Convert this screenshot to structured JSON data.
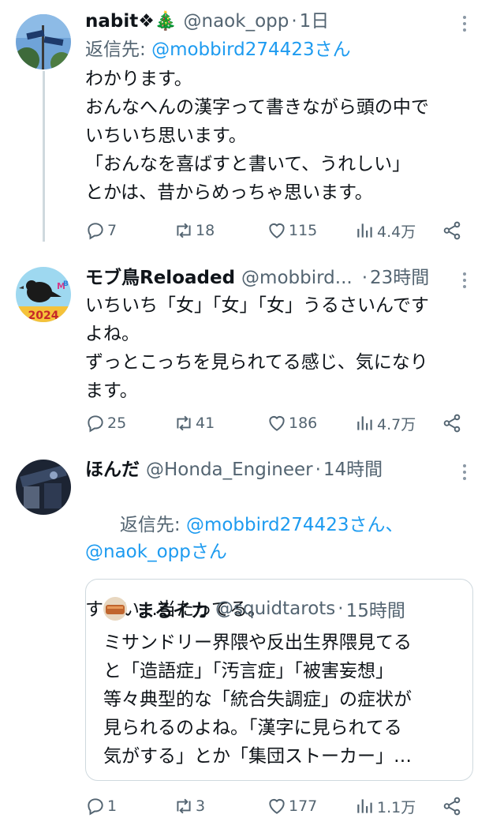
{
  "tweets": [
    {
      "name": "nabit❖🎄",
      "handle": "@naok_opp",
      "dot": "·",
      "time": "1日",
      "reply_prefix": "返信先: ",
      "reply_users": "@mobbird274423さん",
      "text": "わかります。\nおんなへんの漢字って書きながら頭の中で\nいちいち思います。\n「おんなを喜ばすと書いて、うれしい」\nとかは、昔からめっちゃ思います。",
      "replies": "7",
      "retweets": "18",
      "likes": "115",
      "views": "4.4万"
    },
    {
      "name": "モブ鳥Reloaded",
      "handle": "@mobbird...",
      "dot": "·",
      "time": "23時間",
      "avatar_text": "2024",
      "text": "いちいち「女」「女」「女」うるさいんです\nよね。\nずっとこっちを見られてる感じ、気になり\nます。",
      "replies": "25",
      "retweets": "41",
      "likes": "186",
      "views": "4.7万"
    },
    {
      "name": "ほんだ",
      "handle": "@Honda_Engineer",
      "dot": "·",
      "time": "14時間",
      "reply_prefix": "返信先: ",
      "reply_users": "@mobbird274423さん、\n@naok_oppさん",
      "text": "すごい…当たってる。",
      "replies": "1",
      "retweets": "3",
      "likes": "177",
      "views": "1.1万",
      "quote": {
        "name": "まるイカ",
        "handle": "@squidtarots",
        "dot": "·",
        "time": "15時間",
        "text": "ミサンドリー界隈や反出生界隈見てる\nと「造語症」「汚言症」「被害妄想」\n等々典型的な「統合失調症」の症状が\n見られるのよね。「漢字に見られてる\n気がする」とか「集団ストーカー」…"
      }
    }
  ],
  "colors": {
    "text": "#0f1419",
    "secondary": "#536471",
    "link": "#1d9bf0",
    "thread_line": "#cfd9de"
  },
  "icons": [
    "reply-icon",
    "retweet-icon",
    "like-icon",
    "views-icon",
    "share-icon",
    "more-icon"
  ]
}
